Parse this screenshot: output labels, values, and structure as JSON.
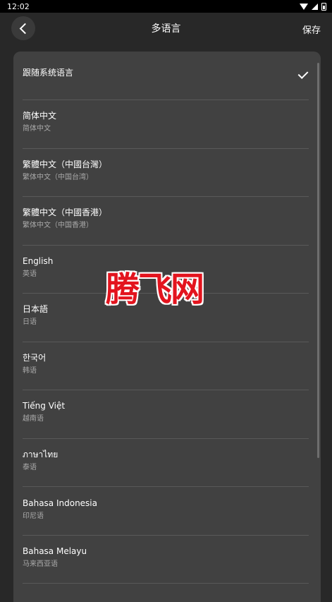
{
  "status_bar": {
    "time": "12:02"
  },
  "header": {
    "title": "多语言",
    "save_label": "保存"
  },
  "languages": [
    {
      "title": "跟随系统语言",
      "subtitle": "",
      "selected": true
    },
    {
      "title": "简体中文",
      "subtitle": "简体中文",
      "selected": false
    },
    {
      "title": "繁體中文（中國台灣）",
      "subtitle": "繁体中文（中国台湾）",
      "selected": false
    },
    {
      "title": "繁體中文（中國香港）",
      "subtitle": "繁体中文（中国香港）",
      "selected": false
    },
    {
      "title": "English",
      "subtitle": "英语",
      "selected": false
    },
    {
      "title": "日本語",
      "subtitle": "日语",
      "selected": false
    },
    {
      "title": "한국어",
      "subtitle": "韩语",
      "selected": false
    },
    {
      "title": "Tiếng Việt",
      "subtitle": "越南语",
      "selected": false
    },
    {
      "title": "ภาษาไทย",
      "subtitle": "泰语",
      "selected": false
    },
    {
      "title": "Bahasa Indonesia",
      "subtitle": "印尼语",
      "selected": false
    },
    {
      "title": "Bahasa Melayu",
      "subtitle": "马来西亚语",
      "selected": false
    }
  ],
  "watermark": "腾飞网",
  "colors": {
    "background": "#282828",
    "panel": "#414141",
    "watermark": "#e3141e"
  }
}
